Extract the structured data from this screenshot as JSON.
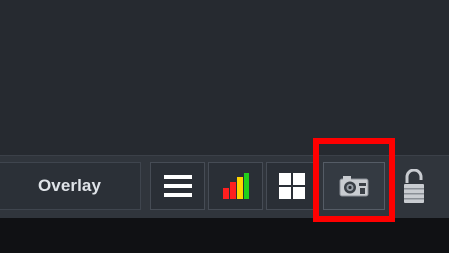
{
  "toolbar": {
    "overlay_label": "Overlay",
    "icons": {
      "menu": "hamburger-menu-icon",
      "signal": "signal-strength-icon",
      "grid": "grid-layout-icon",
      "camera": "camera-icon",
      "lock": "lock-icon"
    },
    "signal_colors": [
      "#ff1f1f",
      "#ffd400",
      "#22d11a"
    ]
  },
  "highlight": {
    "color": "#ff0000"
  }
}
